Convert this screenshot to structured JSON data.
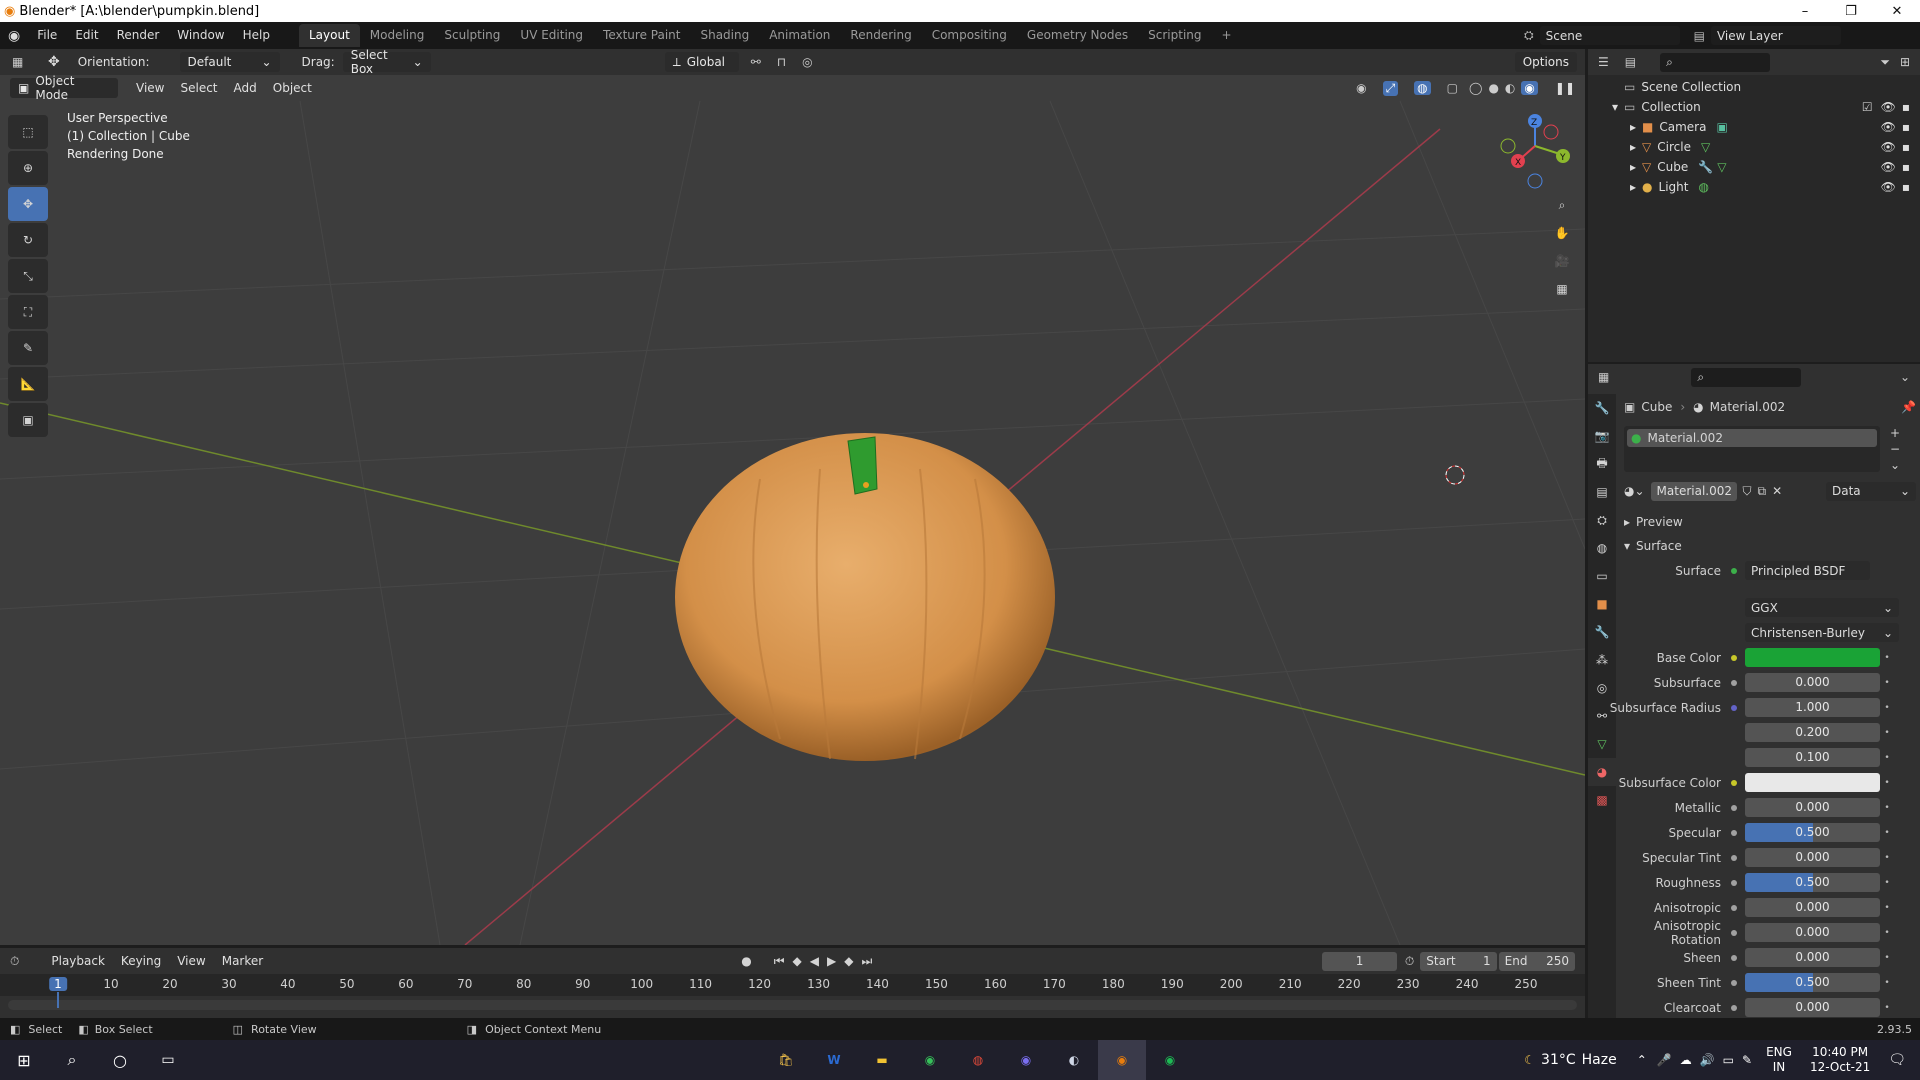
{
  "window": {
    "title": "Blender* [A:\\blender\\pumpkin.blend]",
    "minimize": "–",
    "maximize": "❐",
    "close": "✕"
  },
  "menu": [
    "File",
    "Edit",
    "Render",
    "Window",
    "Help"
  ],
  "workspaces": [
    "Layout",
    "Modeling",
    "Sculpting",
    "UV Editing",
    "Texture Paint",
    "Shading",
    "Animation",
    "Rendering",
    "Compositing",
    "Geometry Nodes",
    "Scripting"
  ],
  "active_workspace": "Layout",
  "scene": {
    "name": "Scene",
    "view_layer": "View Layer"
  },
  "viewport_header": {
    "orientation_label": "Orientation:",
    "orientation_value": "Default",
    "drag_label": "Drag:",
    "drag_value": "Select Box",
    "transform_space": "Global",
    "options": "Options",
    "mode": "Object Mode",
    "view": "View",
    "select": "Select",
    "add": "Add",
    "object": "Object"
  },
  "overlay": {
    "line1": "User Perspective",
    "line2": "(1) Collection | Cube",
    "line3": "Rendering Done"
  },
  "gizmo": {
    "x": "X",
    "y": "Y",
    "z": "Z"
  },
  "outliner": {
    "root": "Scene Collection",
    "collection": "Collection",
    "items": [
      "Camera",
      "Circle",
      "Cube",
      "Light"
    ]
  },
  "properties": {
    "breadcrumb_object": "Cube",
    "breadcrumb_material": "Material.002",
    "slot": "Material.002",
    "material_name": "Material.002",
    "link": "Data",
    "preview": "Preview",
    "surface_panel": "Surface",
    "surface_label": "Surface",
    "surface_value": "Principled BSDF",
    "distribution": "GGX",
    "subsurface_method": "Christensen-Burley",
    "fields": [
      {
        "label": "Base Color",
        "value": "",
        "type": "color",
        "color": "#1aa336"
      },
      {
        "label": "Subsurface",
        "value": "0.000",
        "type": "num",
        "fill": 0
      },
      {
        "label": "Subsurface Radius",
        "value": "1.000",
        "type": "num",
        "fill": 0
      },
      {
        "label": "",
        "value": "0.200",
        "type": "num",
        "fill": 0
      },
      {
        "label": "",
        "value": "0.100",
        "type": "num",
        "fill": 0
      },
      {
        "label": "Subsurface Color",
        "value": "",
        "type": "color",
        "color": "#e8e8e8"
      },
      {
        "label": "Metallic",
        "value": "0.000",
        "type": "num",
        "fill": 0
      },
      {
        "label": "Specular",
        "value": "0.500",
        "type": "num",
        "fill": 0.5
      },
      {
        "label": "Specular Tint",
        "value": "0.000",
        "type": "num",
        "fill": 0
      },
      {
        "label": "Roughness",
        "value": "0.500",
        "type": "num",
        "fill": 0.5
      },
      {
        "label": "Anisotropic",
        "value": "0.000",
        "type": "num",
        "fill": 0
      },
      {
        "label": "Anisotropic Rotation",
        "value": "0.000",
        "type": "num",
        "fill": 0
      },
      {
        "label": "Sheen",
        "value": "0.000",
        "type": "num",
        "fill": 0
      },
      {
        "label": "Sheen Tint",
        "value": "0.500",
        "type": "num",
        "fill": 0.5
      },
      {
        "label": "Clearcoat",
        "value": "0.000",
        "type": "num",
        "fill": 0
      }
    ]
  },
  "timeline": {
    "playback": "Playback",
    "keying": "Keying",
    "view": "View",
    "marker": "Marker",
    "current_frame": "1",
    "start_label": "Start",
    "start": "1",
    "end_label": "End",
    "end": "250",
    "ticks": [
      "1",
      "10",
      "20",
      "30",
      "40",
      "50",
      "60",
      "70",
      "80",
      "90",
      "100",
      "110",
      "120",
      "130",
      "140",
      "150",
      "160",
      "170",
      "180",
      "190",
      "200",
      "210",
      "220",
      "230",
      "240",
      "250"
    ]
  },
  "status": {
    "select": "Select",
    "box_select": "Box Select",
    "rotate": "Rotate View",
    "context": "Object Context Menu",
    "version": "2.93.5"
  },
  "taskbar": {
    "weather_temp": "31°C",
    "weather_text": "Haze",
    "lang1": "ENG",
    "lang2": "IN",
    "time": "10:40 PM",
    "date": "12-Oct-21"
  },
  "colors": {
    "accent": "#4772b3",
    "pumpkin": "#d9964f",
    "stem": "#2f9b2f"
  }
}
